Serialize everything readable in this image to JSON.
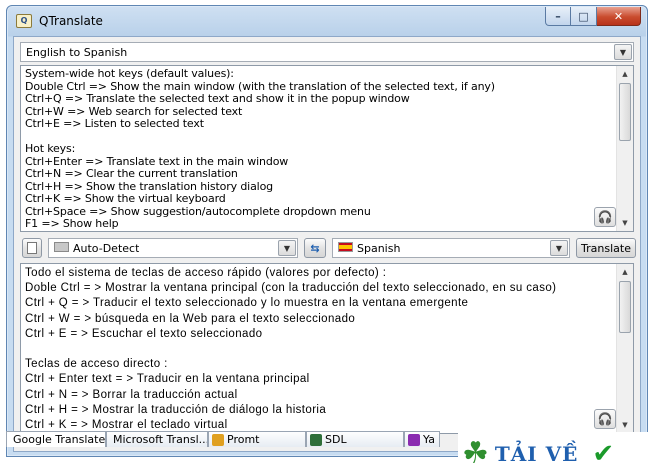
{
  "window": {
    "title": "QTranslate",
    "minimize_glyph": "–",
    "maximize_glyph": "□",
    "close_glyph": "✕",
    "app_icon_glyph": "Q"
  },
  "direction": {
    "value": "English to Spanish",
    "dropdown_glyph": "▼"
  },
  "source_text": {
    "lines": [
      "System-wide hot keys (default values):",
      "Double Ctrl => Show the main window (with the translation of the selected text, if any)",
      "Ctrl+Q => Translate the selected text and show it in the popup window",
      "Ctrl+W => Web search for selected text",
      "Ctrl+E => Listen to selected text",
      "",
      "Hot keys:",
      "Ctrl+Enter => Translate text in the main window",
      "Ctrl+N => Clear the current translation",
      "Ctrl+H => Show the translation history dialog",
      "Ctrl+K => Show the virtual keyboard",
      "Ctrl+Space => Show suggestion/autocomplete dropdown menu",
      "F1 => Show help"
    ]
  },
  "toolbar": {
    "source_lang": "Auto-Detect",
    "target_lang": "Spanish",
    "swap_glyph": "⇆",
    "dropdown_glyph": "▼",
    "translate_label": "Translate"
  },
  "translated_text": {
    "lines": [
      "Todo el sistema de teclas de acceso rápido (valores por defecto) :",
      "Doble Ctrl = > Mostrar la ventana principal (con la traducción del texto seleccionado, en su caso)",
      "Ctrl + Q = > Traducir el texto seleccionado y lo muestra en la ventana emergente",
      "Ctrl + W = > búsqueda en la Web para el texto seleccionado",
      "Ctrl + E = > Escuchar el texto seleccionado",
      "",
      "Teclas de acceso directo :",
      "Ctrl + Enter text = > Traducir en la ventana principal",
      "Ctrl + N = > Borrar la traducción actual",
      "Ctrl + H = > Mostrar la traducción de diálogo la historia",
      "Ctrl + K = > Mostrar el teclado virtual"
    ]
  },
  "scroll_glyphs": {
    "up": "▲",
    "down": "▼"
  },
  "headphones_glyph": "🎧",
  "services": [
    {
      "label": "Google Translate",
      "color": "#4a7fd0"
    },
    {
      "label": "Microsoft Transl...",
      "color": "#5aa34a"
    },
    {
      "label": "Promt",
      "color": "#e0a020"
    },
    {
      "label": "SDL",
      "color": "#2f6f3a"
    },
    {
      "label": "Ya",
      "color": "#8a2bb0"
    }
  ],
  "watermark": {
    "text": "TẢI VỀ",
    "check_glyph": "✔",
    "clover_glyph": "☘"
  },
  "colors": {
    "title_bar": "#b9d1ea",
    "close_button": "#c94c2e",
    "watermark_text": "#1f5fae",
    "watermark_check": "#1a9a2a",
    "watermark_clover": "#2f8f2f"
  }
}
